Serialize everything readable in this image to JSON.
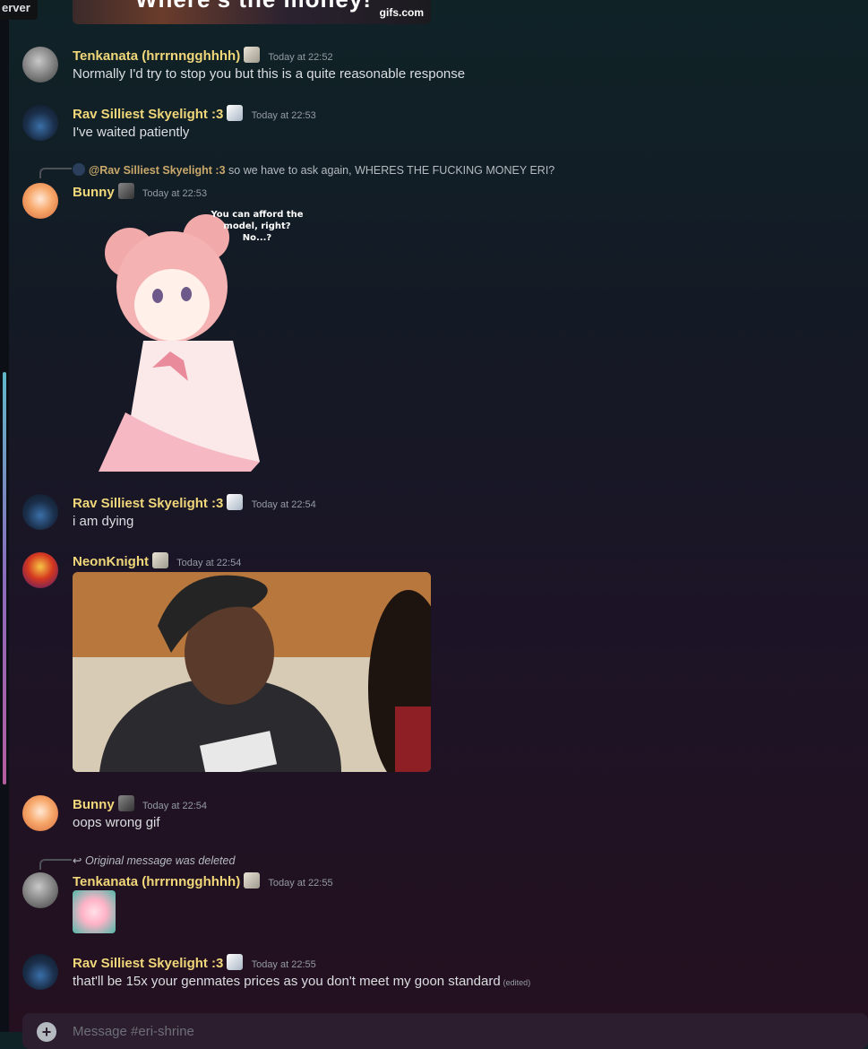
{
  "tooltip": "erver",
  "top_gif": {
    "caption": "Where's the money!",
    "source": "gifs.com"
  },
  "messages": [
    {
      "author": "Tenkanata (hrrrnngghhhh)",
      "time": "Today at 22:52",
      "text": "Normally I'd try to stop you but this is a quite reasonable response"
    },
    {
      "author": "Rav Silliest Skyelight :3",
      "time": "Today at 22:53",
      "text": "I've waited patiently"
    },
    {
      "reply_mention": "@Rav Silliest Skyelight :3",
      "reply_text": "so we have to ask again, WHERES THE FUCKING MONEY ERI?",
      "author": "Bunny",
      "time": "Today at 22:53",
      "sticker_text": "You can afford the model, right? No...?"
    },
    {
      "author": "Rav Silliest Skyelight :3",
      "time": "Today at 22:54",
      "text": "i am dying"
    },
    {
      "author": "NeonKnight",
      "time": "Today at 22:54"
    },
    {
      "author": "Bunny",
      "time": "Today at 22:54",
      "text": "oops wrong gif"
    },
    {
      "reply_deleted": "Original message was deleted",
      "author": "Tenkanata (hrrrnngghhhh)",
      "time": "Today at 22:55"
    },
    {
      "author": "Rav Silliest Skyelight :3",
      "time": "Today at 22:55",
      "text": "that'll be 15x your genmates prices as you don't meet my goon standard",
      "edited": "(edited)"
    }
  ],
  "composer": {
    "placeholder": "Message #eri-shrine"
  }
}
